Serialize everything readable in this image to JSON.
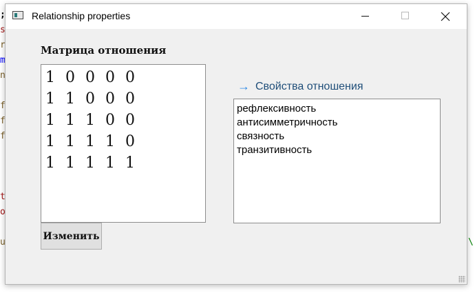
{
  "background_editor": {
    "fragments": [
      ";",
      "s",
      "ri",
      "m",
      "n",
      "f",
      "f",
      "f",
      "t",
      "o",
      "u",
      "\\"
    ]
  },
  "window": {
    "title": "Relationship properties",
    "controls": {
      "minimize_icon": "minimize-icon",
      "maximize_icon": "maximize-icon",
      "close_glyph": "✕"
    }
  },
  "matrix": {
    "label": "Матрица отношения",
    "rows": [
      [
        "1",
        "0",
        "0",
        "0",
        "0"
      ],
      [
        "1",
        "1",
        "0",
        "0",
        "0"
      ],
      [
        "1",
        "1",
        "1",
        "0",
        "0"
      ],
      [
        "1",
        "1",
        "1",
        "1",
        "0"
      ],
      [
        "1",
        "1",
        "1",
        "1",
        "1"
      ]
    ]
  },
  "change_button": {
    "label": "Изменить"
  },
  "properties": {
    "arrow": "→",
    "header": "Свойства отношения",
    "items": [
      "рефлексивность",
      "антисимметричность",
      "связность",
      "транзитивность"
    ]
  },
  "colors": {
    "accent_arrow": "#2e8ae6",
    "header_text": "#1f4e79",
    "window_bg": "#f0f0f0"
  }
}
